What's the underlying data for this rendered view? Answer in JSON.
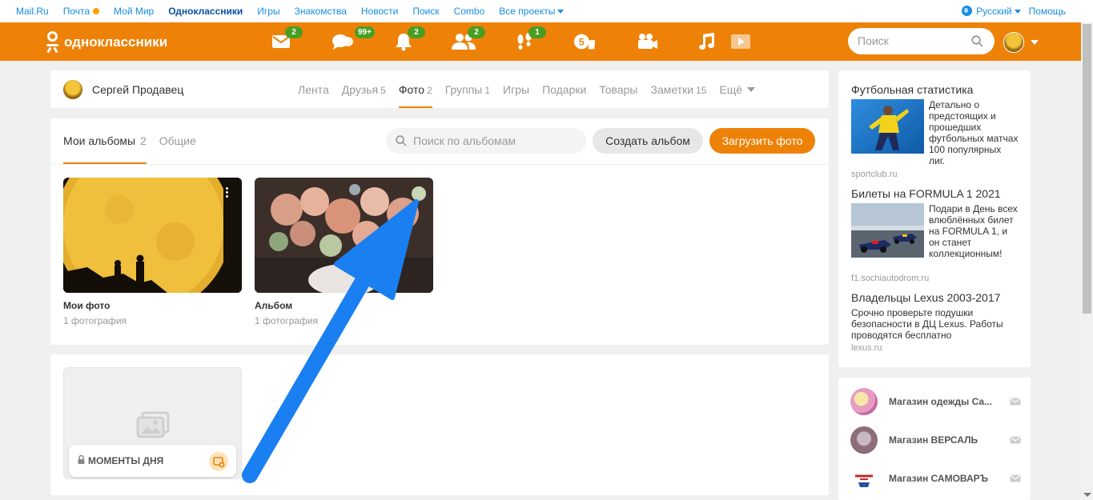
{
  "portal": {
    "links": [
      "Mail.Ru",
      "Почта",
      "Мой Мир",
      "Одноклассники",
      "Игры",
      "Знакомства",
      "Новости",
      "Поиск",
      "Combo",
      "Все проекты"
    ],
    "language": "Русский",
    "help": "Помощь"
  },
  "header": {
    "logo_text": "одноклассники",
    "badges": {
      "messages": "2",
      "discussions": "99+",
      "notifications": "2",
      "friends": "2",
      "guests": "1"
    },
    "search_placeholder": "Поиск"
  },
  "profile": {
    "name": "Сергей Продавец",
    "tabs": [
      {
        "label": "Лента",
        "count": ""
      },
      {
        "label": "Друзья",
        "count": "5"
      },
      {
        "label": "Фото",
        "count": "2"
      },
      {
        "label": "Группы",
        "count": "1"
      },
      {
        "label": "Игры",
        "count": ""
      },
      {
        "label": "Подарки",
        "count": ""
      },
      {
        "label": "Товары",
        "count": ""
      },
      {
        "label": "Заметки",
        "count": "15"
      },
      {
        "label": "Ещё",
        "count": ""
      }
    ]
  },
  "albums": {
    "tab_mine": "Мои альбомы",
    "tab_mine_count": "2",
    "tab_shared": "Общие",
    "search_placeholder": "Поиск по альбомам",
    "create_label": "Создать альбом",
    "upload_label": "Загрузить фото",
    "items": [
      {
        "title": "Мои фото",
        "subtitle": "1 фотография"
      },
      {
        "title": "Альбом",
        "subtitle": "1 фотография"
      }
    ]
  },
  "moments": {
    "label": "МОМЕНТЫ ДНЯ"
  },
  "ads": [
    {
      "title": "Футбольная статистика",
      "text": "Детально о предстоящих и прошедших футбольных матчах 100 популярных лиг.",
      "source": "sportclub.ru"
    },
    {
      "title": "Билеты на FORMULA 1 2021",
      "text": "Подари в День всех влюблённых билет на FORMULA 1, и он станет коллекционным!",
      "source": "f1.sochiautodrom.ru"
    },
    {
      "title": "Владельцы Lexus 2003-2017",
      "text": "Срочно проверьте подушки безопасности в ДЦ Lexus. Работы проводятся бесплатно",
      "source": "lexus.ru"
    }
  ],
  "shops": [
    {
      "name": "Магазин одежды Са..."
    },
    {
      "name": "Магазин ВЕРСАЛЬ"
    },
    {
      "name": "Магазин САМОВАРЪ"
    }
  ],
  "colors": {
    "accent": "#ee8208",
    "link": "#168de2",
    "badge": "#4a9d23",
    "annotation_arrow": "#1a7ff0"
  }
}
